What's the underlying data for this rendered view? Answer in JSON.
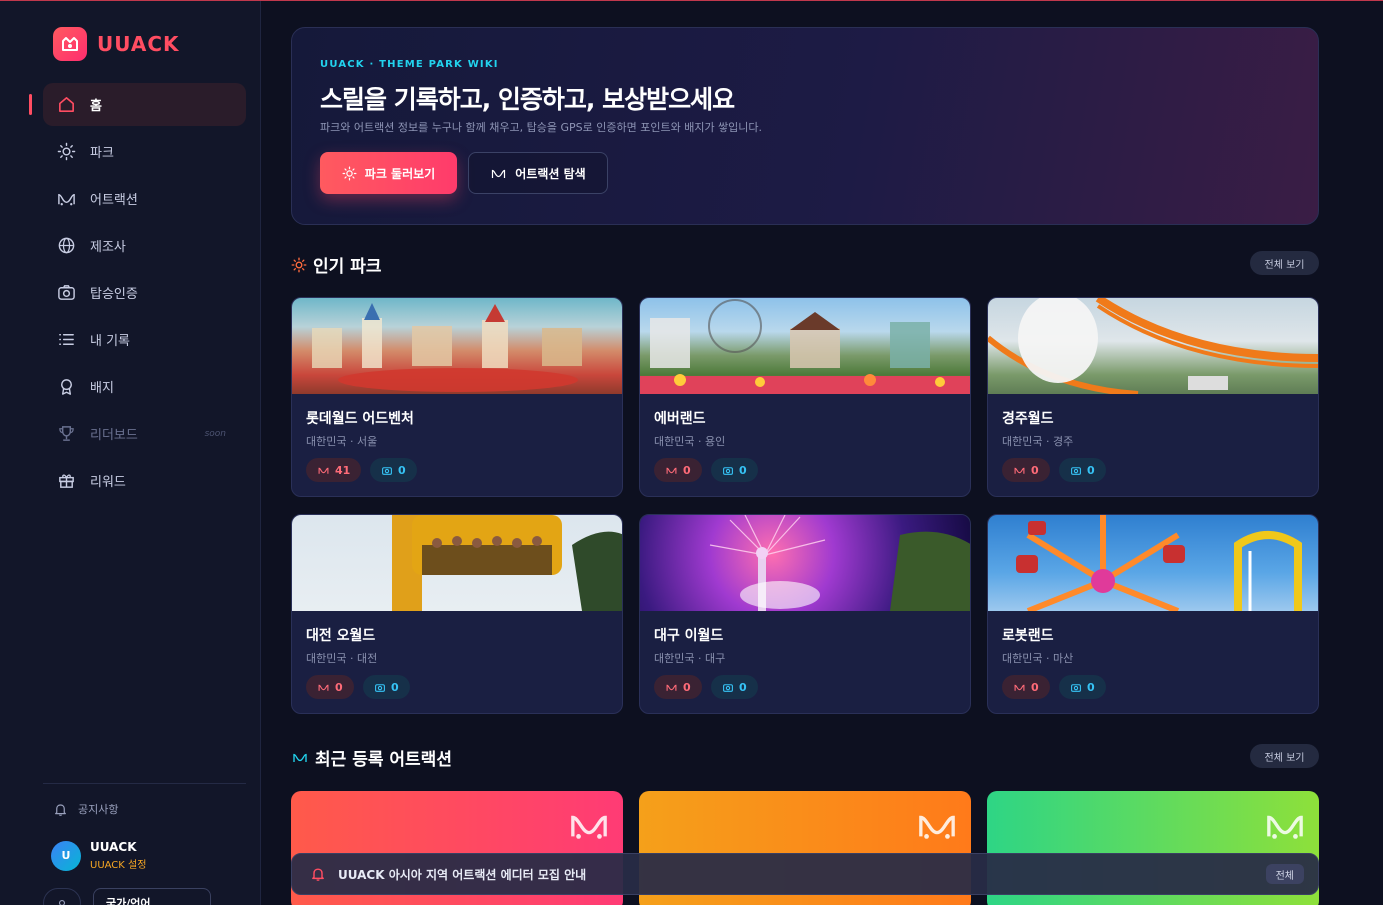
{
  "brand": {
    "name": "UUACK",
    "accent": "#ff4d62"
  },
  "sidebar": {
    "items": [
      {
        "label": "홈",
        "icon": "home-icon",
        "active": true
      },
      {
        "label": "파크",
        "icon": "sun-icon"
      },
      {
        "label": "어트랙션",
        "icon": "coaster-icon"
      },
      {
        "label": "제조사",
        "icon": "globe-icon"
      },
      {
        "label": "탑승인증",
        "icon": "camera-icon"
      },
      {
        "label": "내 기록",
        "icon": "list-icon"
      },
      {
        "label": "배지",
        "icon": "badge-icon"
      },
      {
        "label": "리더보드",
        "icon": "trophy-icon",
        "tag": "soon",
        "disabled": true
      },
      {
        "label": "리워드",
        "icon": "gift-icon"
      }
    ],
    "notice": "공지사항",
    "user": {
      "initial": "U",
      "name": "UUACK",
      "sub": "UUACK 설정"
    },
    "lang_button": "국가/언어"
  },
  "hero": {
    "kicker": "UUACK · THEME PARK WIKI",
    "title": "스릴을 기록하고, 인증하고, 보상받으세요",
    "subtitle": "파크와 어트랙션 정보를 누구나 함께 채우고, 탑승을 GPS로 인증하면 포인트와 배지가 쌓입니다.",
    "primary_button": "파크 둘러보기",
    "secondary_button": "어트랙션 탐색"
  },
  "popular_parks": {
    "title": "인기 파크",
    "see_all": "전체 보기",
    "parks": [
      {
        "name": "롯데월드 어드벤처",
        "location": "대한민국 · 서울",
        "attractions": "41",
        "verifications": "0"
      },
      {
        "name": "에버랜드",
        "location": "대한민국 · 용인",
        "attractions": "0",
        "verifications": "0"
      },
      {
        "name": "경주월드",
        "location": "대한민국 · 경주",
        "attractions": "0",
        "verifications": "0"
      },
      {
        "name": "대전 오월드",
        "location": "대한민국 · 대전",
        "attractions": "0",
        "verifications": "0"
      },
      {
        "name": "대구 이월드",
        "location": "대한민국 · 대구",
        "attractions": "0",
        "verifications": "0"
      },
      {
        "name": "로봇랜드",
        "location": "대한민국 · 마산",
        "attractions": "0",
        "verifications": "0"
      }
    ]
  },
  "recent_attractions": {
    "title": "최근 등록 어트랙션",
    "see_all": "전체 보기"
  },
  "toast": {
    "message": "UUACK 아시아 지역 어트랙션 에디터 모집 안내",
    "button": "전체"
  }
}
